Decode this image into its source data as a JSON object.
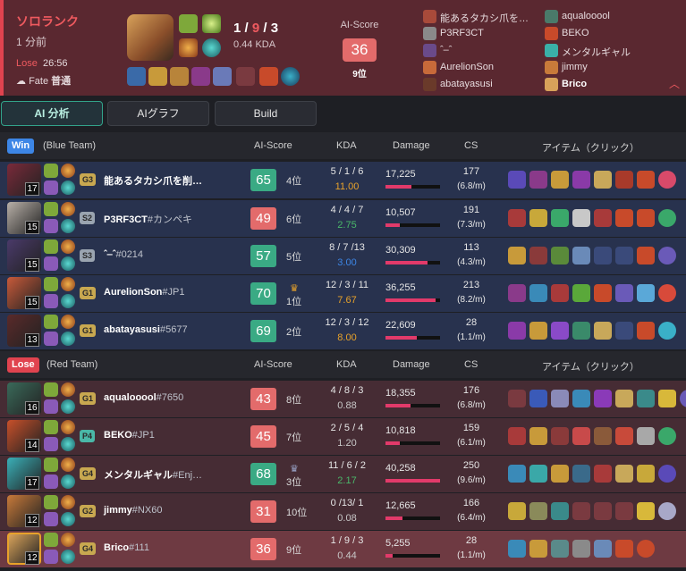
{
  "header": {
    "mode": "ソロランク",
    "ago": "1 分前",
    "result": "Lose",
    "duration": "26:56",
    "fate_label": "Fate",
    "fate_value": "普通",
    "kda_k": "1",
    "kda_d": "9",
    "kda_a": "3",
    "kda_ratio": "0.44 KDA",
    "ai_label": "AI-Score",
    "ai_score": "36",
    "ai_rank": "9位",
    "blue_players": [
      "能あるタカシ爪を…",
      "P3RF3CT",
      "ˆ‒ˆ",
      "AurelionSon",
      "abatayasusi"
    ],
    "red_players": [
      "aqualooool",
      "BEKO",
      "メンタルギャル",
      "jimmy",
      "Brico"
    ]
  },
  "tabs": [
    "AI 分析",
    "AIグラフ",
    "Build"
  ],
  "columns": {
    "ai": "AI-Score",
    "kda": "KDA",
    "damage": "Damage",
    "cs": "CS",
    "items": "アイテム（クリック）"
  },
  "blue_team": {
    "badge": "Win",
    "label": "(Blue Team)",
    "players": [
      {
        "level": "17",
        "tier": "G3",
        "name": "能あるタカシ爪を削…",
        "tag": "",
        "score": "65",
        "rank": "4位",
        "kda": "5 / 1 / 6",
        "ratio": "11.00",
        "cs": "177",
        "csm": "(6.8/m)",
        "damage": "17,225",
        "dmg": 0.47
      },
      {
        "level": "15",
        "tier": "S2",
        "name": "P3RF3CT",
        "tag": "#カンペキ",
        "score": "49",
        "rank": "6位",
        "kda": "4 / 4 / 7",
        "ratio": "2.75",
        "cs": "191",
        "csm": "(7.3/m)",
        "damage": "10,507",
        "dmg": 0.27
      },
      {
        "level": "15",
        "tier": "S3",
        "name": "ˆ‒ˆ",
        "tag": "#0214",
        "score": "57",
        "rank": "5位",
        "kda": "8 / 7 /13",
        "ratio": "3.00",
        "cs": "113",
        "csm": "(4.3/m)",
        "damage": "30,309",
        "dmg": 0.77
      },
      {
        "level": "15",
        "tier": "G1",
        "name": "AurelionSon",
        "tag": "#JP1",
        "score": "70",
        "rank": "1位",
        "kda": "12 / 3 / 11",
        "ratio": "7.67",
        "cs": "213",
        "csm": "(8.2/m)",
        "damage": "36,255",
        "dmg": 0.92
      },
      {
        "level": "13",
        "tier": "G1",
        "name": "abatayasusi",
        "tag": "#5677",
        "score": "69",
        "rank": "2位",
        "kda": "12 / 3 / 12",
        "ratio": "8.00",
        "cs": "28",
        "csm": "(1.1/m)",
        "damage": "22,609",
        "dmg": 0.57
      }
    ]
  },
  "red_team": {
    "badge": "Lose",
    "label": "(Red Team)",
    "players": [
      {
        "level": "16",
        "tier": "G1",
        "name": "aqualooool",
        "tag": "#7650",
        "score": "43",
        "rank": "8位",
        "kda": "4 / 8 / 3",
        "ratio": "0.88",
        "cs": "176",
        "csm": "(6.8/m)",
        "damage": "18,355",
        "dmg": 0.46
      },
      {
        "level": "14",
        "tier": "P4",
        "name": "BEKO",
        "tag": "#JP1",
        "score": "45",
        "rank": "7位",
        "kda": "2 / 5 / 4",
        "ratio": "1.20",
        "cs": "159",
        "csm": "(6.1/m)",
        "damage": "10,818",
        "dmg": 0.27
      },
      {
        "level": "17",
        "tier": "G4",
        "name": "メンタルギャル",
        "tag": "#Enj…",
        "score": "68",
        "rank": "3位",
        "kda": "11 / 6 / 2",
        "ratio": "2.17",
        "cs": "250",
        "csm": "(9.6/m)",
        "damage": "40,258",
        "dmg": 1.0
      },
      {
        "level": "12",
        "tier": "G2",
        "name": "jimmy",
        "tag": "#NX60",
        "score": "31",
        "rank": "10位",
        "kda": "0 /13/ 1",
        "ratio": "0.08",
        "cs": "166",
        "csm": "(6.4/m)",
        "damage": "12,665",
        "dmg": 0.31
      },
      {
        "level": "12",
        "tier": "G4",
        "name": "Brico",
        "tag": "#111",
        "score": "36",
        "rank": "9位",
        "kda": "1 / 9 / 3",
        "ratio": "0.44",
        "cs": "28",
        "csm": "(1.1/m)",
        "damage": "5,255",
        "dmg": 0.13
      }
    ]
  }
}
